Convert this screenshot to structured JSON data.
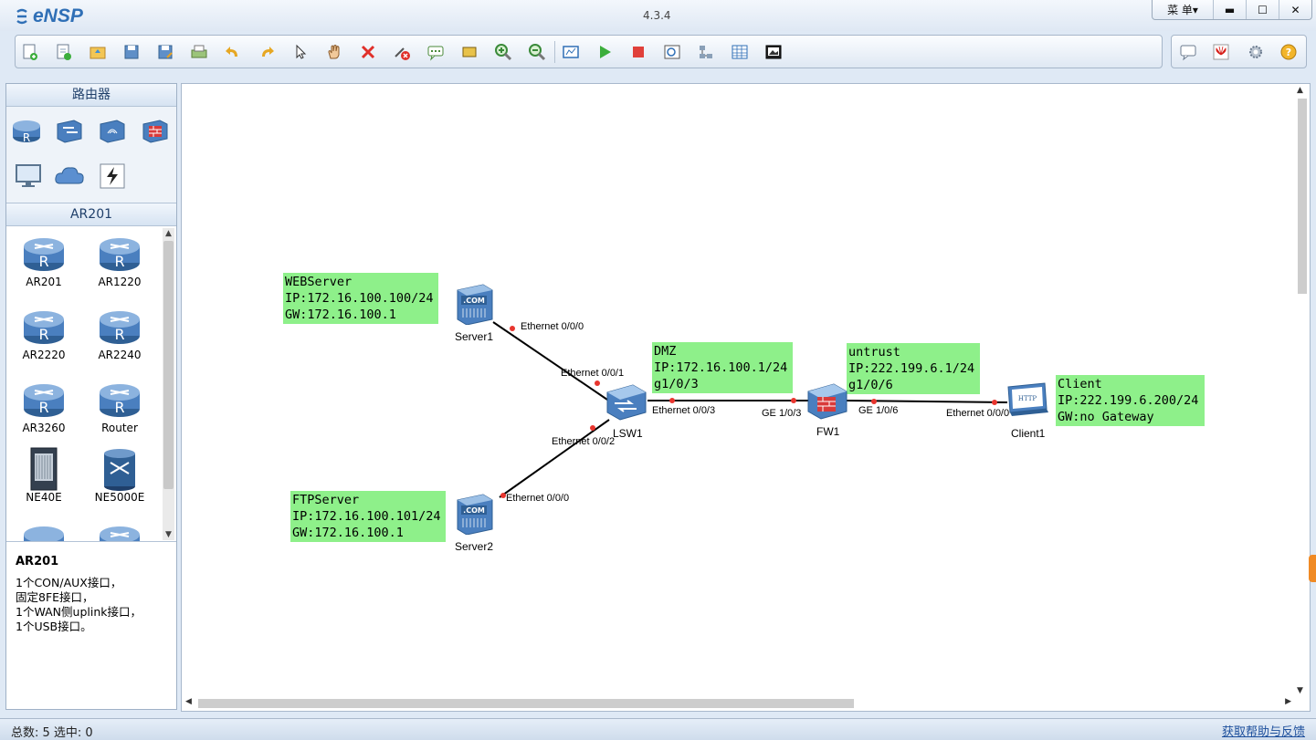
{
  "window": {
    "app_name": "eNSP",
    "version": "4.3.4",
    "menu_label": "菜 单▾",
    "minimize": "▬",
    "maximize": "☐",
    "close": "✕"
  },
  "palette": {
    "category_title": "路由器",
    "selected_group_title": "AR201",
    "devices": [
      {
        "label": "AR201"
      },
      {
        "label": "AR1220"
      },
      {
        "label": "AR2220"
      },
      {
        "label": "AR2240"
      },
      {
        "label": "AR3260"
      },
      {
        "label": "Router"
      },
      {
        "label": "NE40E"
      },
      {
        "label": "NE5000E"
      }
    ],
    "description": {
      "title": "AR201",
      "lines": [
        "1个CON/AUX接口，",
        "固定8FE接口，",
        "1个WAN侧uplink接口，",
        "1个USB接口。"
      ]
    }
  },
  "topology": {
    "nodes": {
      "server1": "Server1",
      "server2": "Server2",
      "lsw1": "LSW1",
      "fw1": "FW1",
      "client1": "Client1"
    },
    "ports": {
      "server1_eth": "Ethernet 0/0/0",
      "lsw1_e1": "Ethernet 0/0/1",
      "lsw1_e2": "Ethernet 0/0/2",
      "lsw1_e3": "Ethernet 0/0/3",
      "server2_eth": "Ethernet 0/0/0",
      "fw1_ge3": "GE 1/0/3",
      "fw1_ge6": "GE 1/0/6",
      "client1_eth": "Ethernet 0/0/0"
    },
    "notes": {
      "webserver": "WEBServer\nIP:172.16.100.100/24\nGW:172.16.100.1",
      "ftpserver": "FTPServer\nIP:172.16.100.101/24\nGW:172.16.100.1",
      "dmz": "DMZ\nIP:172.16.100.1/24\ng1/0/3",
      "untrust": "untrust\nIP:222.199.6.1/24\ng1/0/6",
      "client": "Client\nIP:222.199.6.200/24\nGW:no Gateway"
    }
  },
  "statusbar": {
    "counts": "总数: 5  选中: 0",
    "help_link": "获取帮助与反馈"
  },
  "colors": {
    "note_bg": "#8ef08a",
    "port_dot": "#e8352e",
    "link": "#000000"
  }
}
